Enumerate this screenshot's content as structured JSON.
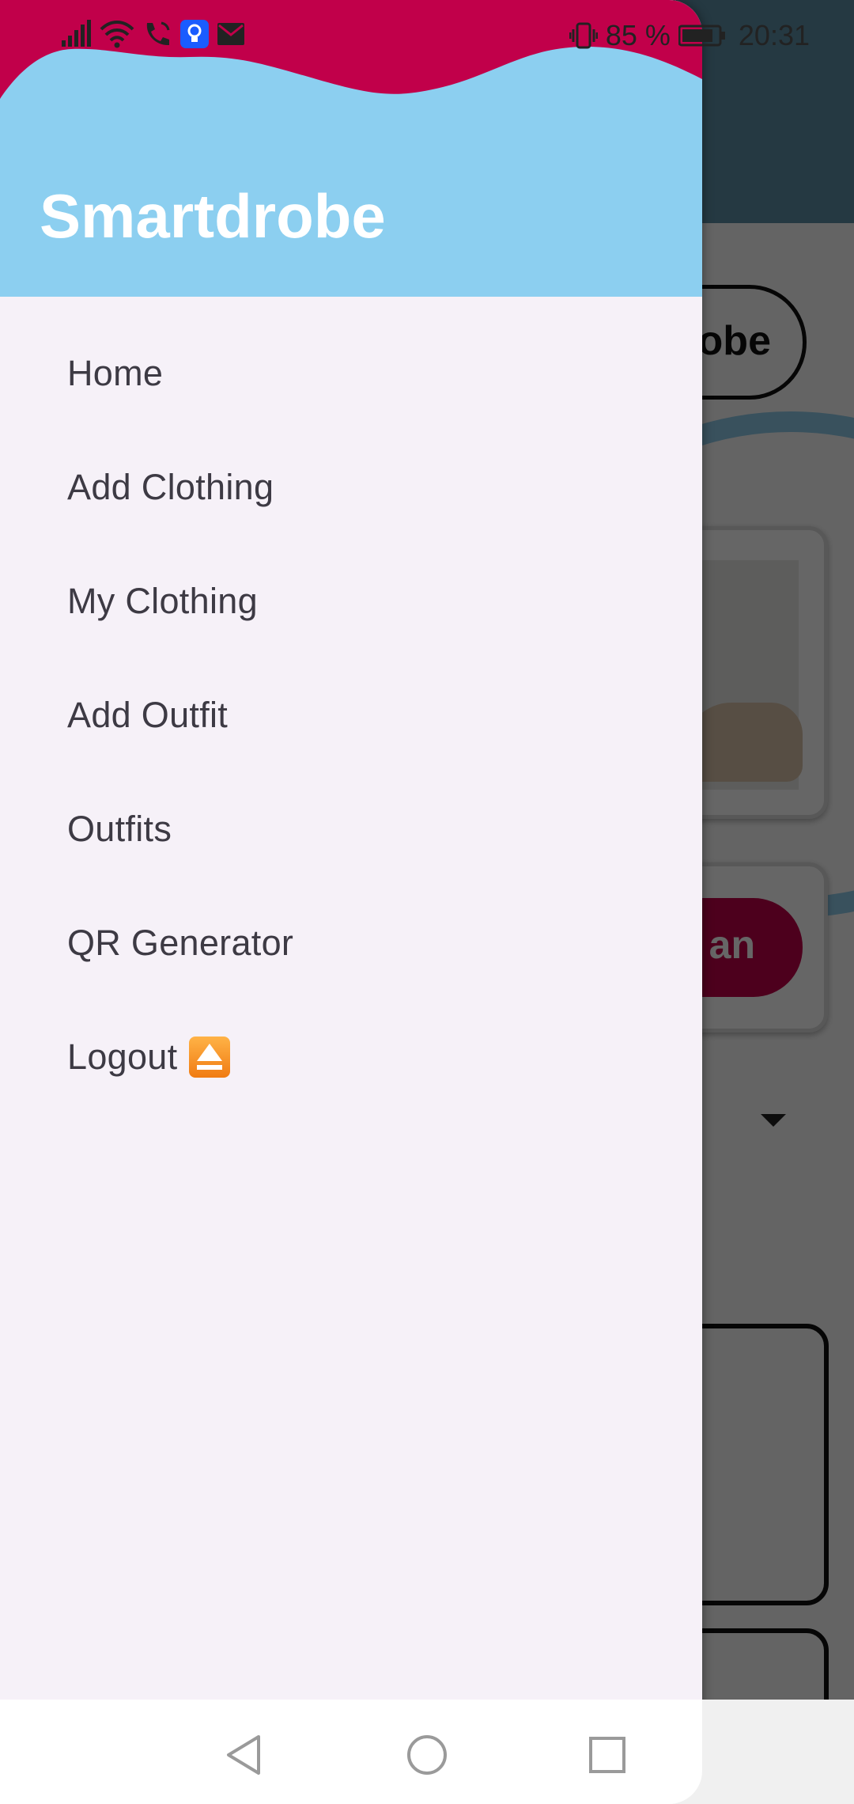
{
  "status_bar": {
    "battery_percent": "85 %",
    "time": "20:31",
    "icons": [
      "signal-icon",
      "wifi-icon",
      "wifi-calling-icon",
      "bulb-notification-icon",
      "mail-icon",
      "vibrate-icon",
      "battery-icon"
    ]
  },
  "background": {
    "pill_text": "obe",
    "button_text": "an"
  },
  "drawer": {
    "title": "Smartdrobe",
    "items": [
      {
        "label": "Home"
      },
      {
        "label": "Add Clothing"
      },
      {
        "label": "My Clothing"
      },
      {
        "label": "Add Outfit"
      },
      {
        "label": "Outfits"
      },
      {
        "label": "QR Generator"
      },
      {
        "label": "Logout"
      }
    ],
    "logout_icon": "eject-icon"
  },
  "colors": {
    "header_blue": "#8ccff0",
    "header_wave": "#c1004a",
    "drawer_bg": "#f6f1f8",
    "accent": "#c1004a"
  },
  "nav_bar": {
    "buttons": [
      "back-icon",
      "home-icon",
      "recents-icon"
    ]
  }
}
